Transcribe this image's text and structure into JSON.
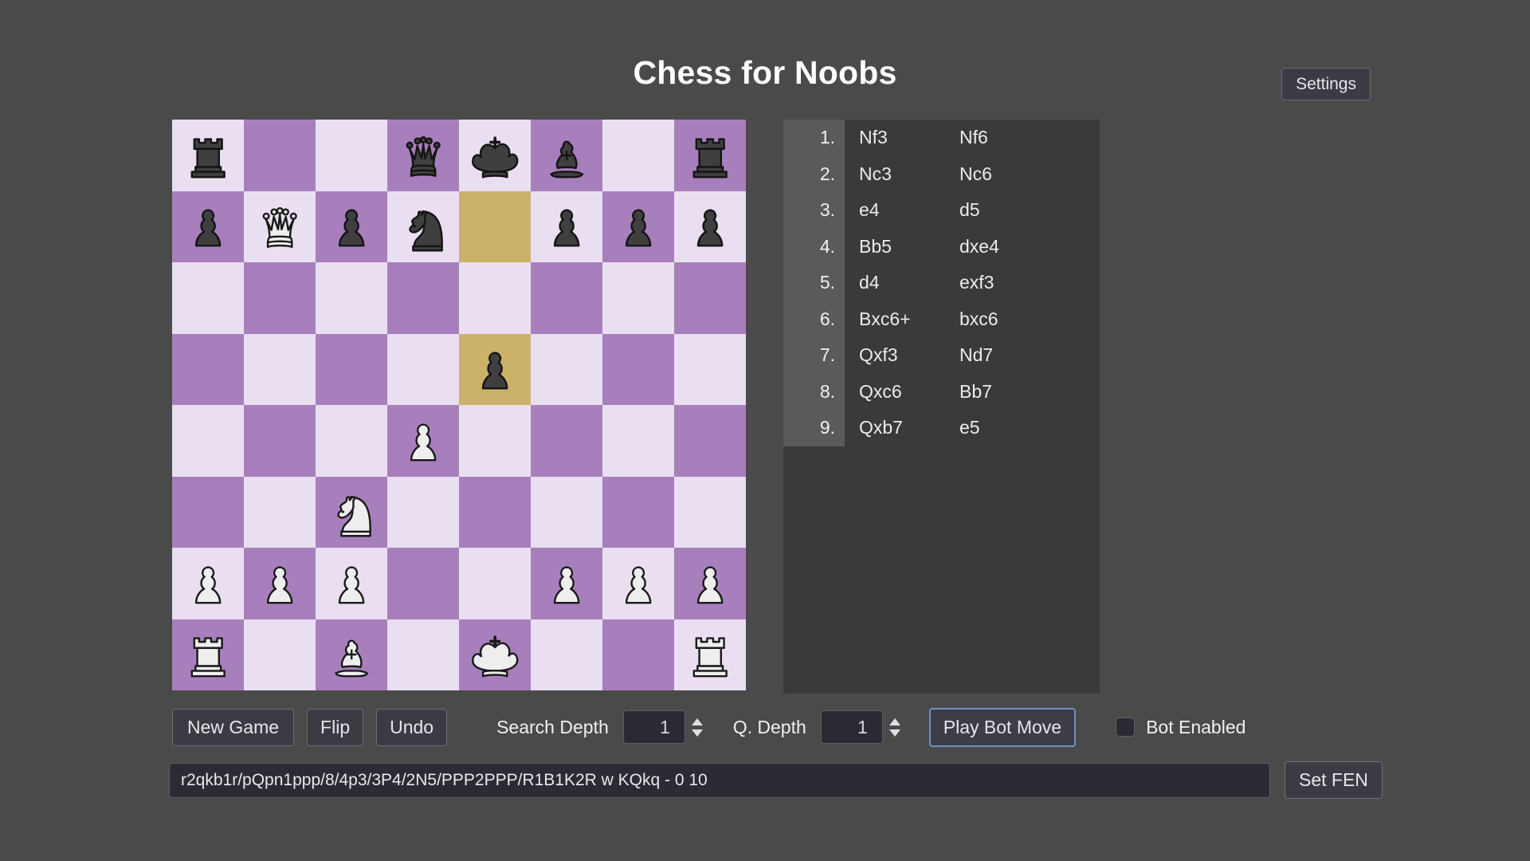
{
  "app": {
    "title": "Chess for Noobs",
    "bg_color": "#4a4a4a"
  },
  "header": {
    "settings_label": "Settings"
  },
  "board": {
    "fen_position": "r2qkb1r/pQpn1ppp/8/4p3/3P4/2N5/PPP2PPP/R1B1K2R",
    "light_square_color": "#e9dff0",
    "dark_square_color": "#a87fbd",
    "highlight_color": "#ccb268",
    "highlighted_squares": [
      "e7",
      "e5"
    ],
    "orientation": "white",
    "ranks": [
      [
        "r",
        "",
        "",
        "q",
        "k",
        "b",
        "",
        "r"
      ],
      [
        "p",
        "Q",
        "p",
        "n",
        "",
        "p",
        "p",
        "p"
      ],
      [
        "",
        "",
        "",
        "",
        "",
        "",
        "",
        ""
      ],
      [
        "",
        "",
        "",
        "",
        "p",
        "",
        "",
        ""
      ],
      [
        "",
        "",
        "",
        "P",
        "",
        "",
        "",
        ""
      ],
      [
        "",
        "",
        "N",
        "",
        "",
        "",
        "",
        ""
      ],
      [
        "P",
        "P",
        "P",
        "",
        "",
        "P",
        "P",
        "P"
      ],
      [
        "R",
        "",
        "B",
        "",
        "K",
        "",
        "",
        "R"
      ]
    ],
    "highlight_flags": [
      [
        false,
        false,
        false,
        false,
        false,
        false,
        false,
        false
      ],
      [
        false,
        false,
        false,
        false,
        true,
        false,
        false,
        false
      ],
      [
        false,
        false,
        false,
        false,
        false,
        false,
        false,
        false
      ],
      [
        false,
        false,
        false,
        false,
        true,
        false,
        false,
        false
      ],
      [
        false,
        false,
        false,
        false,
        false,
        false,
        false,
        false
      ],
      [
        false,
        false,
        false,
        false,
        false,
        false,
        false,
        false
      ],
      [
        false,
        false,
        false,
        false,
        false,
        false,
        false,
        false
      ],
      [
        false,
        false,
        false,
        false,
        false,
        false,
        false,
        false
      ]
    ]
  },
  "movelist": {
    "moves": [
      {
        "num": "1.",
        "white": "Nf3",
        "black": "Nf6"
      },
      {
        "num": "2.",
        "white": "Nc3",
        "black": "Nc6"
      },
      {
        "num": "3.",
        "white": "e4",
        "black": "d5"
      },
      {
        "num": "4.",
        "white": "Bb5",
        "black": "dxe4"
      },
      {
        "num": "5.",
        "white": "d4",
        "black": "exf3"
      },
      {
        "num": "6.",
        "white": "Bxc6+",
        "black": "bxc6"
      },
      {
        "num": "7.",
        "white": "Qxf3",
        "black": "Nd7"
      },
      {
        "num": "8.",
        "white": "Qxc6",
        "black": "Bb7"
      },
      {
        "num": "9.",
        "white": "Qxb7",
        "black": "e5"
      }
    ]
  },
  "controls": {
    "new_game_label": "New Game",
    "flip_label": "Flip",
    "undo_label": "Undo",
    "search_depth_label": "Search Depth",
    "search_depth_value": "1",
    "q_depth_label": "Q. Depth",
    "q_depth_value": "1",
    "play_bot_move_label": "Play Bot Move",
    "bot_enabled_label": "Bot Enabled",
    "bot_enabled_checked": false
  },
  "fen": {
    "value": "r2qkb1r/pQpn1ppp/8/4p3/3P4/2N5/PPP2PPP/R1B1K2R w KQkq - 0 10",
    "placeholder": "FEN",
    "set_fen_label": "Set FEN"
  }
}
